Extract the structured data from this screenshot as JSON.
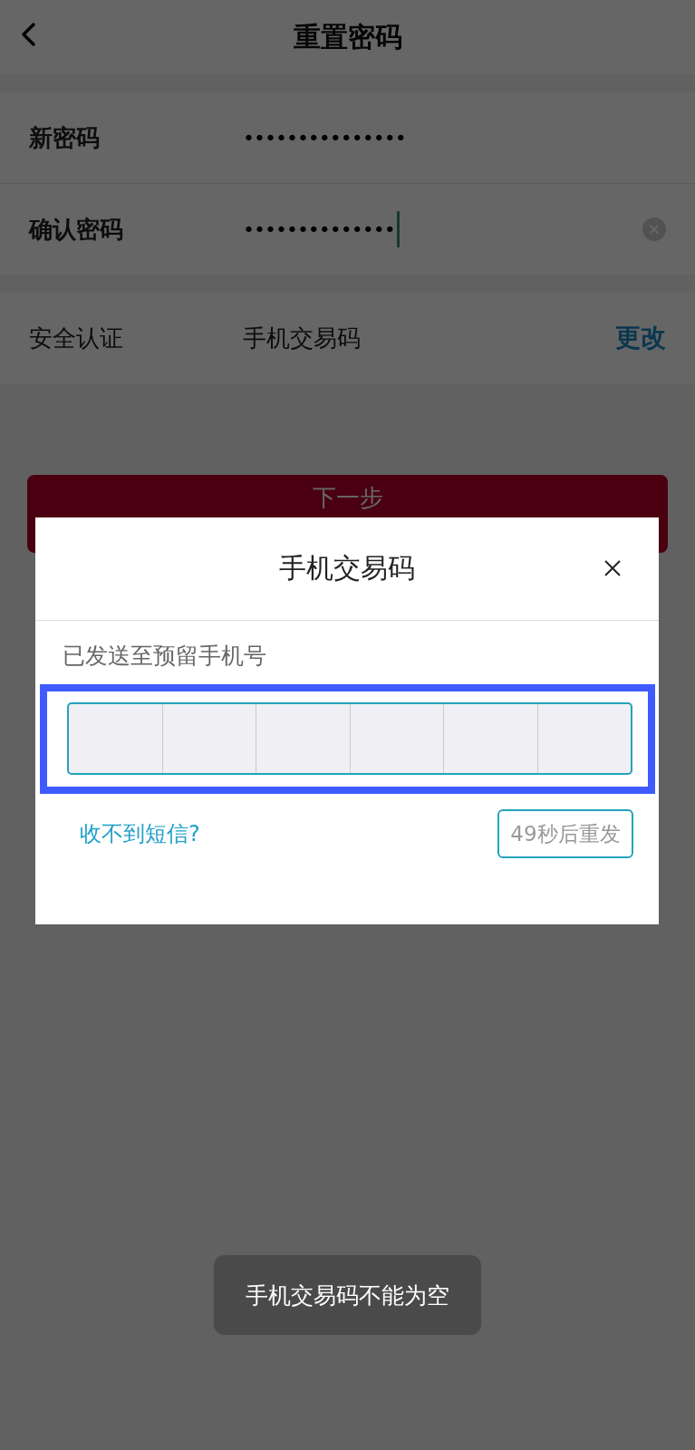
{
  "header": {
    "title": "重置密码"
  },
  "password_fields": [
    {
      "label": "新密码",
      "value": "•••••••••••••••",
      "focused": false,
      "clear_button": false
    },
    {
      "label": "确认密码",
      "value": "••••••••••••••",
      "focused": true,
      "clear_button": true
    }
  ],
  "security": {
    "label": "安全认证",
    "value": "手机交易码",
    "action": "更改"
  },
  "next_button": {
    "label": "下一步"
  },
  "dialog": {
    "title": "手机交易码",
    "hint": "已发送至预留手机号",
    "code_cells": [
      {
        "filled": false
      },
      {
        "filled": false
      },
      {
        "filled": false
      },
      {
        "filled": false
      },
      {
        "filled": false
      },
      {
        "filled": false
      }
    ],
    "highlighted": true,
    "help_link": "收不到短信?",
    "resend_button": {
      "label": "49秒后重发",
      "disabled": true
    }
  },
  "toast": "手机交易码不能为空"
}
